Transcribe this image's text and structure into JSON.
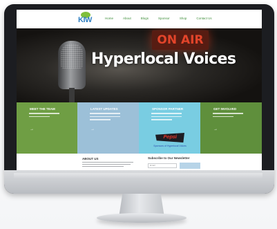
{
  "site": {
    "logo_text": "KIW",
    "nav": [
      "Home",
      "About",
      "Blogs",
      "Sponsor",
      "Shop",
      "Contact Us"
    ]
  },
  "hero": {
    "title": "Hyperlocal Voices",
    "sign_text": "ON AIR"
  },
  "panels": [
    {
      "title": "MEET THE TEAM"
    },
    {
      "title": "LATEST UPDATES"
    },
    {
      "title": "SPONSOR PARTNER",
      "sponsor_name": "Pepsi",
      "sponsor_caption": "Sponsors of Hyperlocal Voices"
    },
    {
      "title": "GET INVOLVED"
    }
  ],
  "below": {
    "about_title": "ABOUT US",
    "newsletter_title": "Subscribe to Our Newsletter",
    "newsletter_placeholder": "Email"
  },
  "colors": {
    "panel_green": "#6f9e44",
    "panel_blue": "#9cc0d8",
    "panel_cyan": "#79cde2",
    "panel_dark_green": "#5f8f3c",
    "nav_green": "#3e8e3a"
  }
}
